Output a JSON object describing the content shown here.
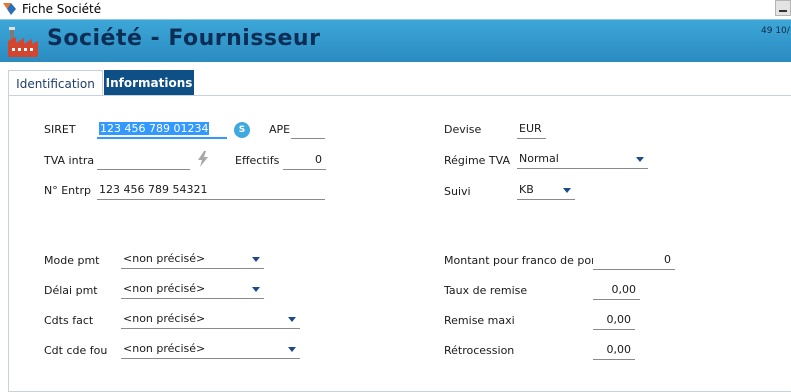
{
  "window": {
    "title": "Fiche Société"
  },
  "header": {
    "title": "Société - Fournisseur",
    "record_info": "49  10/"
  },
  "tabs": [
    {
      "label": "Identification",
      "active": false
    },
    {
      "label": "Informations",
      "active": true
    }
  ],
  "form": {
    "siret": {
      "label": "SIRET",
      "value": "123 456 789 01234",
      "action_icon": "S"
    },
    "ape": {
      "label": "APE",
      "value": ""
    },
    "tva_intra": {
      "label": "TVA intra",
      "value": ""
    },
    "effectifs": {
      "label": "Effectifs",
      "value": "0"
    },
    "n_entrp": {
      "label": "N° Entrp",
      "value": "123 456 789 54321"
    },
    "devise": {
      "label": "Devise",
      "value": "EUR"
    },
    "regime_tva": {
      "label": "Régime TVA",
      "value": "Normal"
    },
    "suivi": {
      "label": "Suivi",
      "value": "KB"
    },
    "mode_pmt": {
      "label": "Mode pmt",
      "value": "<non précisé>"
    },
    "delai_pmt": {
      "label": "Délai pmt",
      "value": "<non précisé>"
    },
    "cdts_fact": {
      "label": "Cdts fact",
      "value": "<non précisé>"
    },
    "cdt_cde_fou": {
      "label": "Cdt cde fou",
      "value": "<non précisé>"
    },
    "franco": {
      "label": "Montant pour franco de port",
      "value": "0"
    },
    "taux_remise": {
      "label": "Taux de remise",
      "value": "0,00"
    },
    "remise_maxi": {
      "label": "Remise maxi",
      "value": "0,00"
    },
    "retrocession": {
      "label": "Rétrocession",
      "value": "0,00"
    }
  },
  "colors": {
    "header_bg": "#2a8bc0",
    "title_text": "#0c2e56",
    "active_tab": "#0e4f86",
    "selection": "#3399ff"
  }
}
